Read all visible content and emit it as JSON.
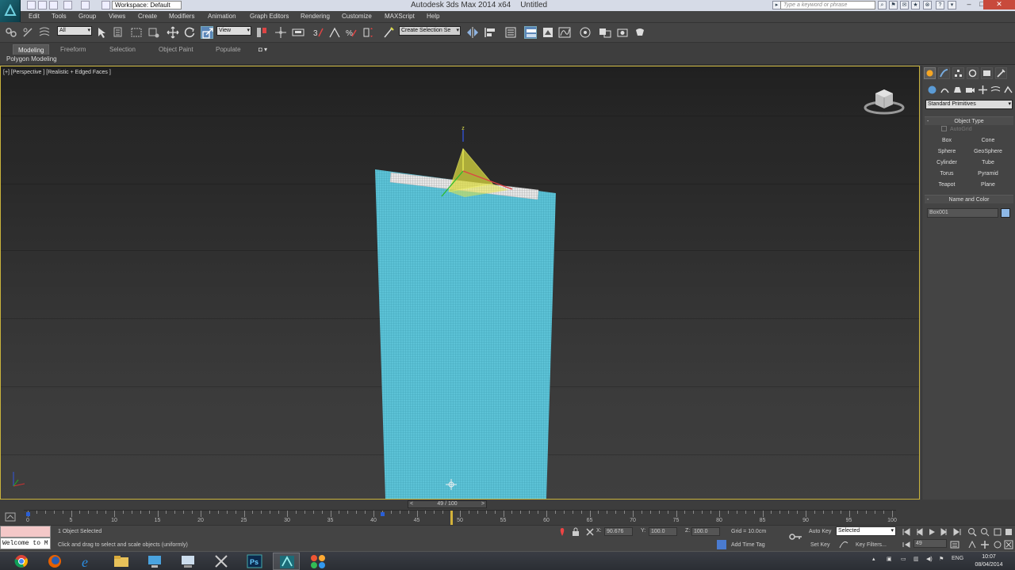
{
  "window": {
    "title": "Autodesk 3ds Max  2014 x64",
    "document": "Untitled",
    "workspace": "Workspace: Default",
    "search_placeholder": "Type a keyword or phrase"
  },
  "menu": [
    "Edit",
    "Tools",
    "Group",
    "Views",
    "Create",
    "Modifiers",
    "Animation",
    "Graph Editors",
    "Rendering",
    "Customize",
    "MAXScript",
    "Help"
  ],
  "toolbar": {
    "selection_filter": "All",
    "reference_coord": "View",
    "named_selection": "Create Selection Se"
  },
  "ribbon": {
    "tabs": [
      "Modeling",
      "Freeform",
      "Selection",
      "Object Paint",
      "Populate"
    ],
    "subtitle": "Polygon Modeling"
  },
  "viewport": {
    "label": "[+] [Perspective ] [Realistic + Edged Faces ]",
    "gizmo_axis": "z"
  },
  "command_panel": {
    "category": "Standard Primitives",
    "object_type_title": "Object Type",
    "autogrid": "AutoGrid",
    "primitives": [
      "Box",
      "Cone",
      "Sphere",
      "GeoSphere",
      "Cylinder",
      "Tube",
      "Torus",
      "Pyramid",
      "Teapot",
      "Plane"
    ],
    "name_color_title": "Name and Color",
    "object_name": "Box001",
    "object_color": "#8eb8e6"
  },
  "timeline": {
    "slider_label": "49 / 100",
    "current_frame": 49,
    "ticks": [
      0,
      5,
      10,
      15,
      20,
      25,
      30,
      35,
      40,
      45,
      50,
      55,
      60,
      65,
      70,
      75,
      80,
      85,
      90,
      95,
      100
    ],
    "key_frame": 41
  },
  "status": {
    "maxscript_text": "Welcome to M",
    "selection_count": "1 Object Selected",
    "prompt": "Click and drag to select and scale objects (uniformly)",
    "x_label": "X:",
    "x_value": "90.676",
    "y_label": "Y:",
    "y_value": "100.0",
    "z_label": "Z:",
    "z_value": "100.0",
    "grid": "Grid = 10.0cm",
    "add_time_tag": "Add Time Tag",
    "auto_key": "Auto Key",
    "set_key": "Set Key",
    "selected": "Selected",
    "key_filters": "Key Filters...",
    "frame_field": "49"
  },
  "taskbar": {
    "lang": "ENG",
    "time": "10:07",
    "date": "08/04/2014"
  },
  "colors": {
    "mesh": "#5cc2d6",
    "viewport_border": "#c9b33c",
    "gizmo": "#e5e64a"
  }
}
